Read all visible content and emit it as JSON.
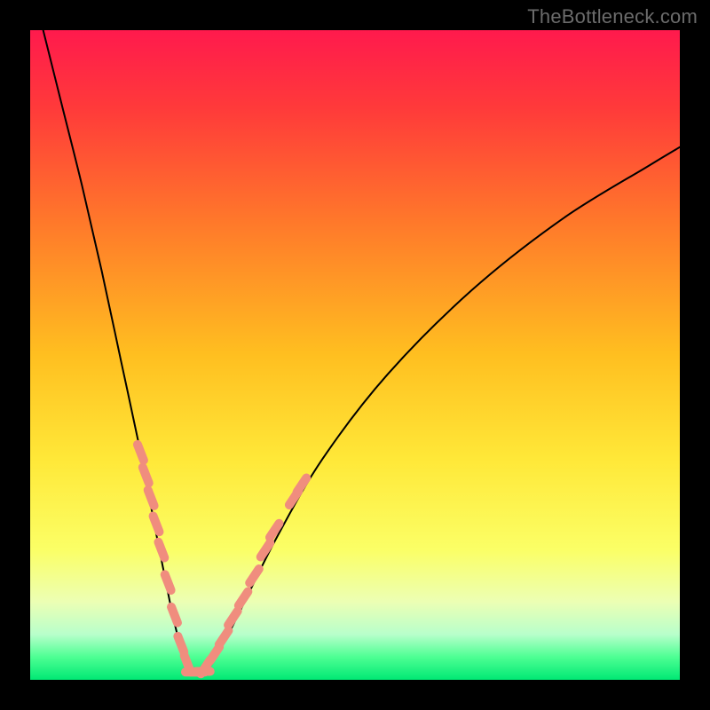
{
  "watermark": "TheBottleneck.com",
  "chart_data": {
    "type": "line",
    "title": "",
    "xlabel": "",
    "ylabel": "",
    "ylim": [
      0,
      100
    ],
    "xlim": [
      0,
      100
    ],
    "background_gradient": {
      "stops": [
        {
          "pos": 0.0,
          "color": "#ff1a4d"
        },
        {
          "pos": 0.12,
          "color": "#ff3a3a"
        },
        {
          "pos": 0.3,
          "color": "#ff7a2a"
        },
        {
          "pos": 0.5,
          "color": "#ffbf20"
        },
        {
          "pos": 0.66,
          "color": "#ffe838"
        },
        {
          "pos": 0.8,
          "color": "#fbff66"
        },
        {
          "pos": 0.88,
          "color": "#ecffb4"
        },
        {
          "pos": 0.93,
          "color": "#b8ffcb"
        },
        {
          "pos": 0.965,
          "color": "#4dff93"
        },
        {
          "pos": 1.0,
          "color": "#00e874"
        }
      ]
    },
    "series": [
      {
        "name": "bottleneck-curve",
        "description": "V-shaped black curve: steep left descent to a minimum near x≈25, then a shallower rise to the right",
        "x": [
          2,
          5,
          8,
          11,
          14,
          17,
          19.5,
          21.5,
          23,
          24,
          25,
          26.5,
          28,
          30,
          33,
          38,
          45,
          55,
          68,
          82,
          95,
          100
        ],
        "values": [
          100,
          88,
          76,
          63,
          49,
          35,
          22,
          12,
          5.5,
          2,
          1,
          1,
          2.5,
          6,
          12,
          22,
          34,
          47,
          60,
          71,
          79,
          82
        ]
      }
    ],
    "point_clusters": {
      "description": "Salmon-colored segment markers overlaid on the curve in the lower region",
      "color": "#f08d7e",
      "left_branch": [
        {
          "x": 17.0,
          "y": 35.0
        },
        {
          "x": 17.8,
          "y": 31.5
        },
        {
          "x": 18.6,
          "y": 28.0
        },
        {
          "x": 19.4,
          "y": 24.0
        },
        {
          "x": 20.2,
          "y": 20.0
        },
        {
          "x": 21.2,
          "y": 15.0
        },
        {
          "x": 22.2,
          "y": 10.0
        },
        {
          "x": 23.2,
          "y": 5.5
        },
        {
          "x": 24.2,
          "y": 2.5
        }
      ],
      "right_branch": [
        {
          "x": 27.0,
          "y": 2.0
        },
        {
          "x": 28.4,
          "y": 4.0
        },
        {
          "x": 29.8,
          "y": 6.5
        },
        {
          "x": 31.2,
          "y": 9.5
        },
        {
          "x": 32.8,
          "y": 12.5
        },
        {
          "x": 34.5,
          "y": 16.0
        },
        {
          "x": 36.2,
          "y": 20.0
        },
        {
          "x": 37.6,
          "y": 23.0
        },
        {
          "x": 40.6,
          "y": 28.0
        },
        {
          "x": 41.8,
          "y": 30.0
        }
      ],
      "bottom": [
        {
          "x": 25.0,
          "y": 1.2
        },
        {
          "x": 25.8,
          "y": 1.2
        },
        {
          "x": 26.6,
          "y": 1.3
        }
      ]
    }
  }
}
